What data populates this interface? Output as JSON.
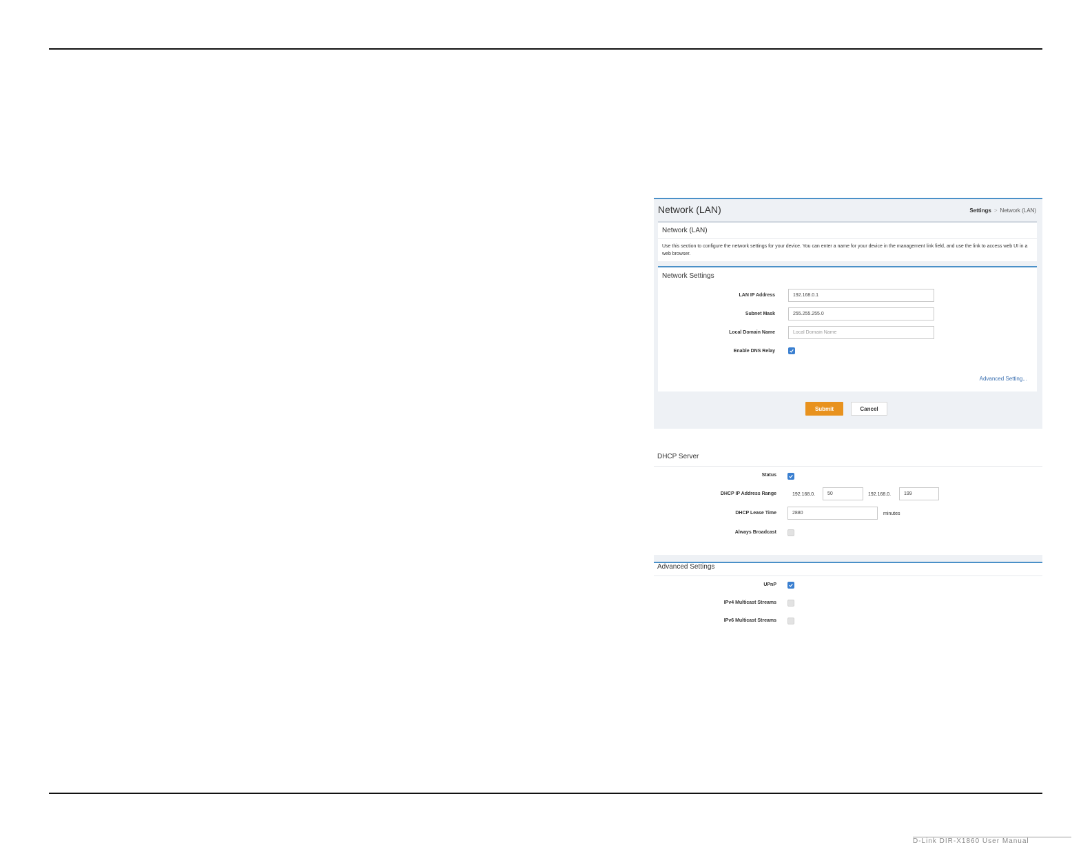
{
  "footer": {
    "fragment": "D-Link DIR-X1860 User Manual"
  },
  "lan": {
    "page_title": "Network (LAN)",
    "breadcrumb": {
      "root": "Settings",
      "separator": ">",
      "current": "Network (LAN)"
    },
    "intro": {
      "title": "Network (LAN)",
      "text": "Use this section to configure the network settings for your device. You can enter a name for your device in the management link field, and use the link to access web UI in a web browser."
    },
    "settings": {
      "title": "Network Settings",
      "lan_ip": {
        "label": "LAN IP Address",
        "value": "192.168.0.1"
      },
      "subnet": {
        "label": "Subnet Mask",
        "value": "255.255.255.0"
      },
      "domain": {
        "label": "Local Domain Name",
        "value": "",
        "placeholder": "Local Domain Name"
      },
      "dns_relay": {
        "label": "Enable DNS Relay",
        "checked": true
      },
      "advanced_link": "Advanced Setting..."
    },
    "buttons": {
      "submit": "Submit",
      "cancel": "Cancel"
    }
  },
  "dhcp": {
    "title": "DHCP Server",
    "status": {
      "label": "Status",
      "checked": true
    },
    "range": {
      "label": "DHCP IP Address Range",
      "start_prefix": "192.168.0.",
      "start_value": "50",
      "end_prefix": "192.168.0.",
      "end_value": "199"
    },
    "lease": {
      "label": "DHCP Lease Time",
      "value": "2880",
      "unit": "minutes"
    },
    "broadcast": {
      "label": "Always Broadcast",
      "checked": false
    }
  },
  "advanced": {
    "title": "Advanced Settings",
    "upnp": {
      "label": "UPnP",
      "checked": true
    },
    "ipv4_multicast": {
      "label": "IPv4 Multicast Streams",
      "checked": false
    },
    "ipv6_multicast": {
      "label": "IPv6 Multicast Streams",
      "checked": false
    }
  },
  "colors": {
    "accent": "#4a90c8",
    "submit": "#e8921e",
    "checkbox_on": "#3a7fd0",
    "panel_bg": "#eef1f5"
  }
}
